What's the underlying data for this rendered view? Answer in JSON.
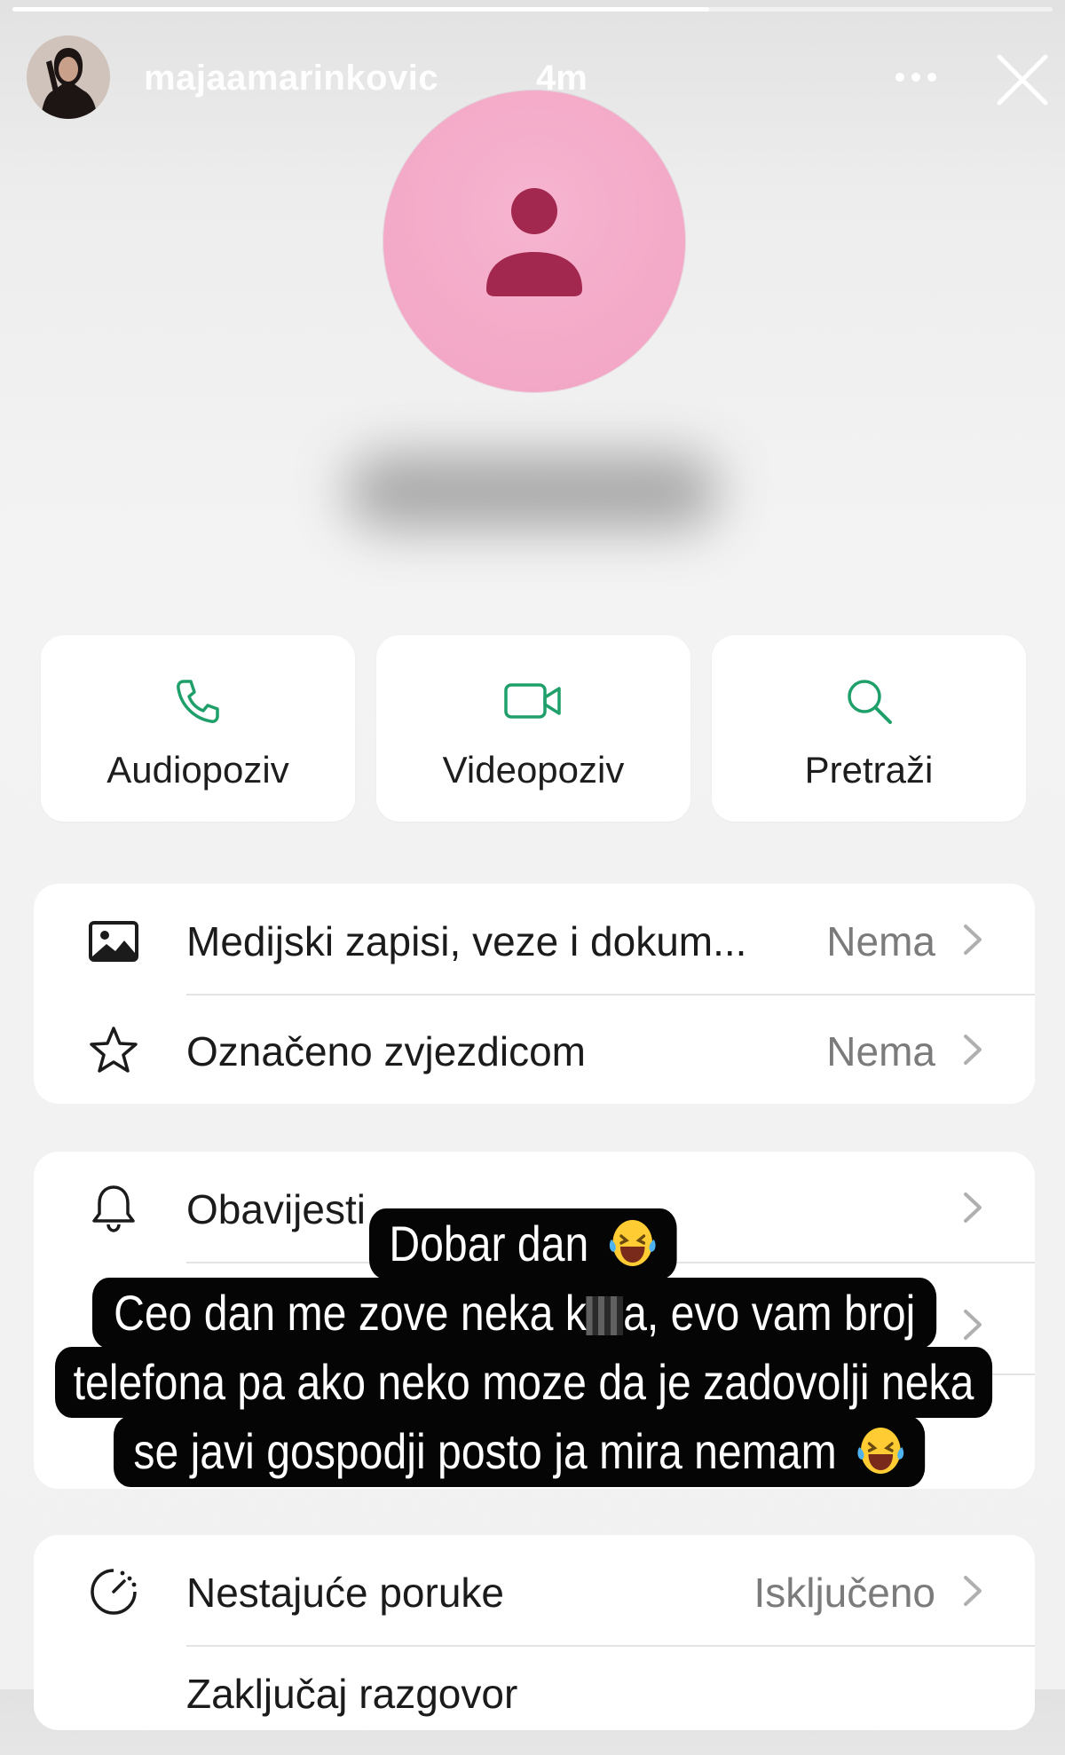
{
  "story": {
    "username": "majaamarinkovic",
    "time_ago": "4m",
    "progress_fraction": 0.67
  },
  "actions": [
    {
      "label": "Audiopoziv",
      "icon": "phone-icon"
    },
    {
      "label": "Videopoziv",
      "icon": "video-camera-icon"
    },
    {
      "label": "Pretraži",
      "icon": "search-icon"
    }
  ],
  "rows": {
    "media": {
      "label": "Medijski zapisi, veze i dokum...",
      "value": "Nema",
      "icon": "image-icon"
    },
    "starred": {
      "label": "Označeno zvjezdicom",
      "value": "Nema",
      "icon": "star-icon"
    },
    "notifications": {
      "label": "Obavijesti",
      "icon": "bell-icon"
    },
    "disappearing": {
      "label": "Nestajuće poruke",
      "value": "Isključeno",
      "icon": "timer-icon"
    },
    "lock": {
      "label": "Zaključaj razgovor"
    }
  },
  "caption": {
    "line1": "Dobar dan",
    "line2a": "Ceo dan me zove neka k",
    "line2b": "a, evo vam broj",
    "line3": "telefona pa ako neko moze da je zadovolji neka",
    "line4": "se javi gospodji posto ja mira nemam"
  },
  "colors": {
    "accent_green": "#1fa06a",
    "avatar_pink": "#f4a9c8",
    "avatar_silhouette": "#a3284f"
  }
}
